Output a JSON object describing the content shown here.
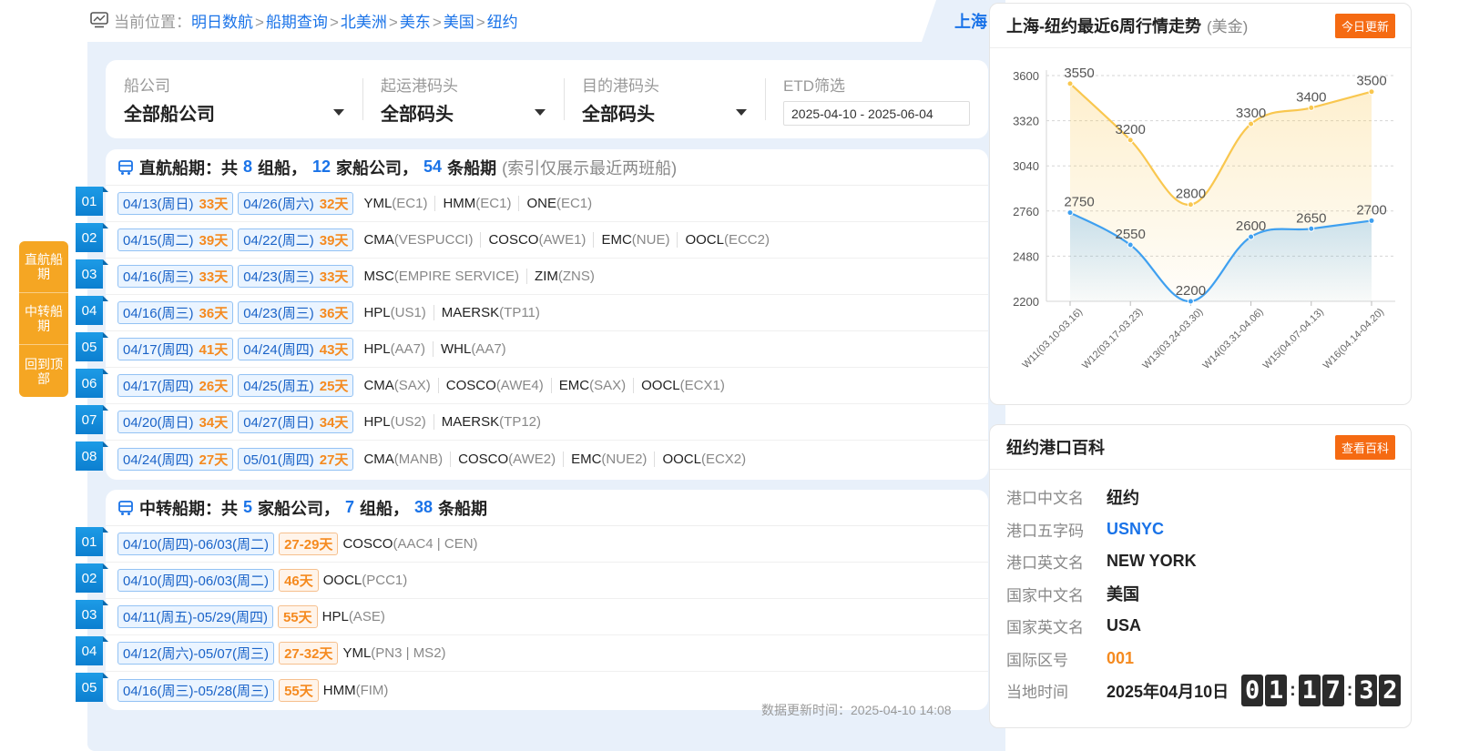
{
  "breadcrumb": {
    "lead": "当前位置：",
    "items": [
      "明日数航",
      "船期查询",
      "北美洲",
      "美东",
      "美国",
      "纽约"
    ],
    "separator": ">"
  },
  "city_tab": "上海",
  "filters": {
    "carrier": {
      "label": "船公司",
      "value": "全部船公司"
    },
    "origin_terminal": {
      "label": "起运港码头",
      "value": "全部码头"
    },
    "dest_terminal": {
      "label": "目的港码头",
      "value": "全部码头"
    },
    "etd": {
      "label": "ETD筛选",
      "value": "2025-04-10 - 2025-06-04"
    }
  },
  "direct": {
    "title_prefix": "直航船期：共",
    "groups": "8",
    "groups_unit": "组船，",
    "carriers": "12",
    "carriers_unit": "家船公司，",
    "schedules": "54",
    "schedules_unit": "条船期",
    "note": "(索引仅展示最近两班船)",
    "rows": [
      {
        "num": "01",
        "tags": [
          {
            "date": "04/13(周日)",
            "days": "33天"
          },
          {
            "date": "04/26(周六)",
            "days": "32天"
          }
        ],
        "carriers": [
          {
            "name": "YML",
            "svc": "(EC1)"
          },
          {
            "name": "HMM",
            "svc": "(EC1)"
          },
          {
            "name": "ONE",
            "svc": "(EC1)"
          }
        ]
      },
      {
        "num": "02",
        "tags": [
          {
            "date": "04/15(周二)",
            "days": "39天"
          },
          {
            "date": "04/22(周二)",
            "days": "39天"
          }
        ],
        "carriers": [
          {
            "name": "CMA",
            "svc": "(VESPUCCI)"
          },
          {
            "name": "COSCO",
            "svc": "(AWE1)"
          },
          {
            "name": "EMC",
            "svc": "(NUE)"
          },
          {
            "name": "OOCL",
            "svc": "(ECC2)"
          }
        ]
      },
      {
        "num": "03",
        "tags": [
          {
            "date": "04/16(周三)",
            "days": "33天"
          },
          {
            "date": "04/23(周三)",
            "days": "33天"
          }
        ],
        "carriers": [
          {
            "name": "MSC",
            "svc": "(EMPIRE SERVICE)"
          },
          {
            "name": "ZIM",
            "svc": "(ZNS)"
          }
        ]
      },
      {
        "num": "04",
        "tags": [
          {
            "date": "04/16(周三)",
            "days": "36天"
          },
          {
            "date": "04/23(周三)",
            "days": "36天"
          }
        ],
        "carriers": [
          {
            "name": "HPL",
            "svc": "(US1)"
          },
          {
            "name": "MAERSK",
            "svc": "(TP11)"
          }
        ]
      },
      {
        "num": "05",
        "tags": [
          {
            "date": "04/17(周四)",
            "days": "41天"
          },
          {
            "date": "04/24(周四)",
            "days": "43天"
          }
        ],
        "carriers": [
          {
            "name": "HPL",
            "svc": "(AA7)"
          },
          {
            "name": "WHL",
            "svc": "(AA7)"
          }
        ]
      },
      {
        "num": "06",
        "tags": [
          {
            "date": "04/17(周四)",
            "days": "26天"
          },
          {
            "date": "04/25(周五)",
            "days": "25天"
          }
        ],
        "carriers": [
          {
            "name": "CMA",
            "svc": "(SAX)"
          },
          {
            "name": "COSCO",
            "svc": "(AWE4)"
          },
          {
            "name": "EMC",
            "svc": "(SAX)"
          },
          {
            "name": "OOCL",
            "svc": "(ECX1)"
          }
        ]
      },
      {
        "num": "07",
        "tags": [
          {
            "date": "04/20(周日)",
            "days": "34天"
          },
          {
            "date": "04/27(周日)",
            "days": "34天"
          }
        ],
        "carriers": [
          {
            "name": "HPL",
            "svc": "(US2)"
          },
          {
            "name": "MAERSK",
            "svc": "(TP12)"
          }
        ]
      },
      {
        "num": "08",
        "tags": [
          {
            "date": "04/24(周四)",
            "days": "27天"
          },
          {
            "date": "05/01(周四)",
            "days": "27天"
          }
        ],
        "carriers": [
          {
            "name": "CMA",
            "svc": "(MANB)"
          },
          {
            "name": "COSCO",
            "svc": "(AWE2)"
          },
          {
            "name": "EMC",
            "svc": "(NUE2)"
          },
          {
            "name": "OOCL",
            "svc": "(ECX2)"
          }
        ]
      }
    ]
  },
  "transfer": {
    "title_prefix": "中转船期：共",
    "carriers": "5",
    "carriers_unit": "家船公司，",
    "groups": "7",
    "groups_unit": "组船，",
    "schedules": "38",
    "schedules_unit": "条船期",
    "rows": [
      {
        "num": "01",
        "range": "04/10(周四)-06/03(周二)",
        "days": "27-29天",
        "carrier": "COSCO",
        "svc": "(AAC4 | CEN)"
      },
      {
        "num": "02",
        "range": "04/10(周四)-06/03(周二)",
        "days": "46天",
        "carrier": "OOCL",
        "svc": "(PCC1)"
      },
      {
        "num": "03",
        "range": "04/11(周五)-05/29(周四)",
        "days": "55天",
        "carrier": "HPL",
        "svc": "(ASE)"
      },
      {
        "num": "04",
        "range": "04/12(周六)-05/07(周三)",
        "days": "27-32天",
        "carrier": "YML",
        "svc": "(PN3 | MS2)"
      },
      {
        "num": "05",
        "range": "04/16(周三)-05/28(周三)",
        "days": "55天",
        "carrier": "HMM",
        "svc": "(FIM)"
      }
    ]
  },
  "update_time": "数据更新时间：2025-04-10 14:08",
  "float_nav": [
    "直航船期",
    "中转船期",
    "回到顶部"
  ],
  "trend": {
    "title": "上海-纽约最近6周行情走势",
    "unit": "(美金)",
    "button": "今日更新"
  },
  "chart_data": {
    "type": "line",
    "categories": [
      "W11(03.10-03.16)",
      "W12(03.17-03.23)",
      "W13(03.24-03.30)",
      "W14(03.31-04.06)",
      "W15(04.07-04.13)",
      "W16(04.14-04.20)"
    ],
    "series": [
      {
        "values": [
          3550,
          3200,
          2800,
          3300,
          3400,
          3500
        ],
        "color": "#f9c74f",
        "area": true
      },
      {
        "values": [
          2750,
          2550,
          2200,
          2600,
          2650,
          2700
        ],
        "color": "#3fa0f0",
        "area": true
      }
    ],
    "yticks": [
      2200,
      2480,
      2760,
      3040,
      3320,
      3600
    ],
    "ylim": [
      2200,
      3600
    ],
    "grid": true,
    "smooth": true
  },
  "wiki": {
    "title": "纽约港口百科",
    "button": "查看百科",
    "rows": [
      {
        "label": "港口中文名",
        "value": "纽约",
        "style": ""
      },
      {
        "label": "港口五字码",
        "value": "USNYC",
        "style": "blue"
      },
      {
        "label": "港口英文名",
        "value": "NEW YORK",
        "style": ""
      },
      {
        "label": "国家中文名",
        "value": "美国",
        "style": ""
      },
      {
        "label": "国家英文名",
        "value": "USA",
        "style": ""
      },
      {
        "label": "国际区号",
        "value": "001",
        "style": "orange"
      }
    ],
    "local_time_label": "当地时间",
    "local_date": "2025年04月10日",
    "clock": [
      "0",
      "1",
      "1",
      "7",
      "3",
      "2"
    ]
  }
}
